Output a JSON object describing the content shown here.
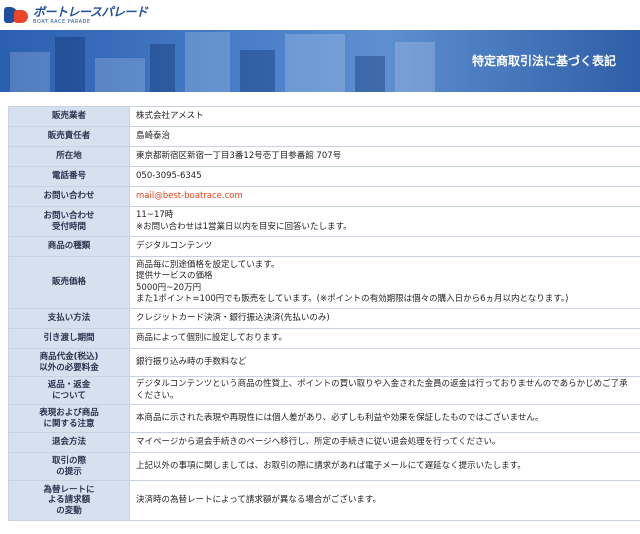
{
  "header": {
    "logo_jp": "ボートレースパレード",
    "logo_en": "BOAT RACE PARADE",
    "banner_title": "特定商取引法に基づく表記"
  },
  "rows": [
    {
      "label": "販売業者",
      "value": "株式会社アメスト"
    },
    {
      "label": "販売責任者",
      "value": "島崎泰治"
    },
    {
      "label": "所在地",
      "value": "東京都新宿区新宿一丁目3番12号壱丁目参番館 707号"
    },
    {
      "label": "電話番号",
      "value": "050-3095-6345"
    },
    {
      "label": "お問い合わせ",
      "value": "mail@best-boatrace.com"
    },
    {
      "label": "お問い合わせ\n受付時間",
      "value": "11~17時\n※お問い合わせは1営業日以内を目安に回答いたします。"
    },
    {
      "label": "商品の種類",
      "value": "デジタルコンテンツ"
    },
    {
      "label": "販売価格",
      "value": "商品毎に別途価格を設定しています。\n提供サービスの価格\n5000円~20万円\nまた1ポイント=100円でも販売をしています。(※ポイントの有効期限は個々の購入日から6ヵ月以内となります。)"
    },
    {
      "label": "支払い方法",
      "value": "クレジットカード決済・銀行振込決済(先払いのみ)"
    },
    {
      "label": "引き渡し期間",
      "value": "商品によって個別に設定しております。"
    },
    {
      "label": "商品代金(税込)\n以外の必要料金",
      "value": "銀行振り込み時の手数料など"
    },
    {
      "label": "返品・返金\nについて",
      "value": "デジタルコンテンツという商品の性質上、ポイントの買い取りや入金された金員の返金は行っておりませんのであらかじめご了承ください。"
    },
    {
      "label": "表現および商品\nに関する注意",
      "value": "本商品に示された表現や再現性には個人差があり、必ずしも利益や効果を保証したものではございません。"
    },
    {
      "label": "退会方法",
      "value": "マイページから退会手続きのページへ移行し、所定の手続きに従い退会処理を行ってください。"
    },
    {
      "label": "取引の際\nの提示",
      "value": "上記以外の事項に関しましては、お取引の際に請求があれば電子メールにて遅延なく提示いたします。"
    },
    {
      "label": "為替レートに\nよる請求額\nの変動",
      "value": "決済時の為替レートによって請求額が異なる場合がございます。"
    }
  ]
}
